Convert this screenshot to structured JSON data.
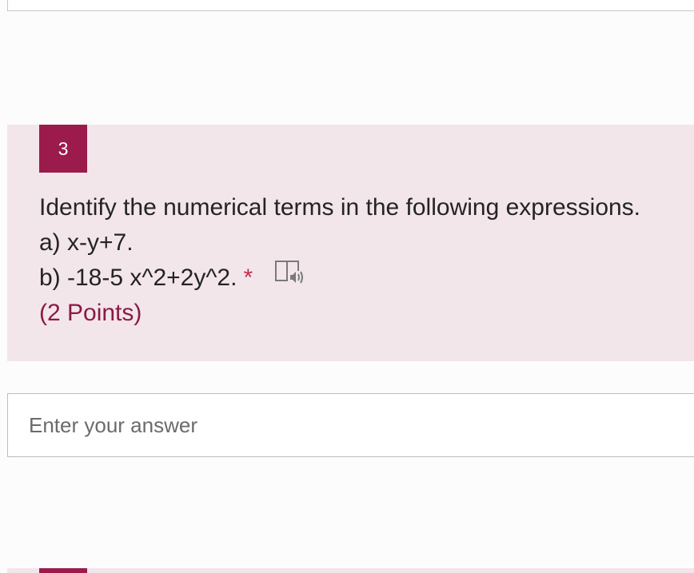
{
  "question": {
    "number": "3",
    "lines": [
      "Identify the numerical terms in the following expressions.",
      "a) x-y+7.",
      "b) -18-5 x^2+2y^2."
    ],
    "required_marker": "*",
    "points": "(2 Points)",
    "reader_icon": "immersive-reader-icon"
  },
  "answer": {
    "placeholder": "Enter your answer",
    "value": ""
  },
  "colors": {
    "card_background": "#f3e6ea",
    "accent": "#9b1b4d",
    "required": "#c4314b",
    "points": "#8a1a44"
  }
}
